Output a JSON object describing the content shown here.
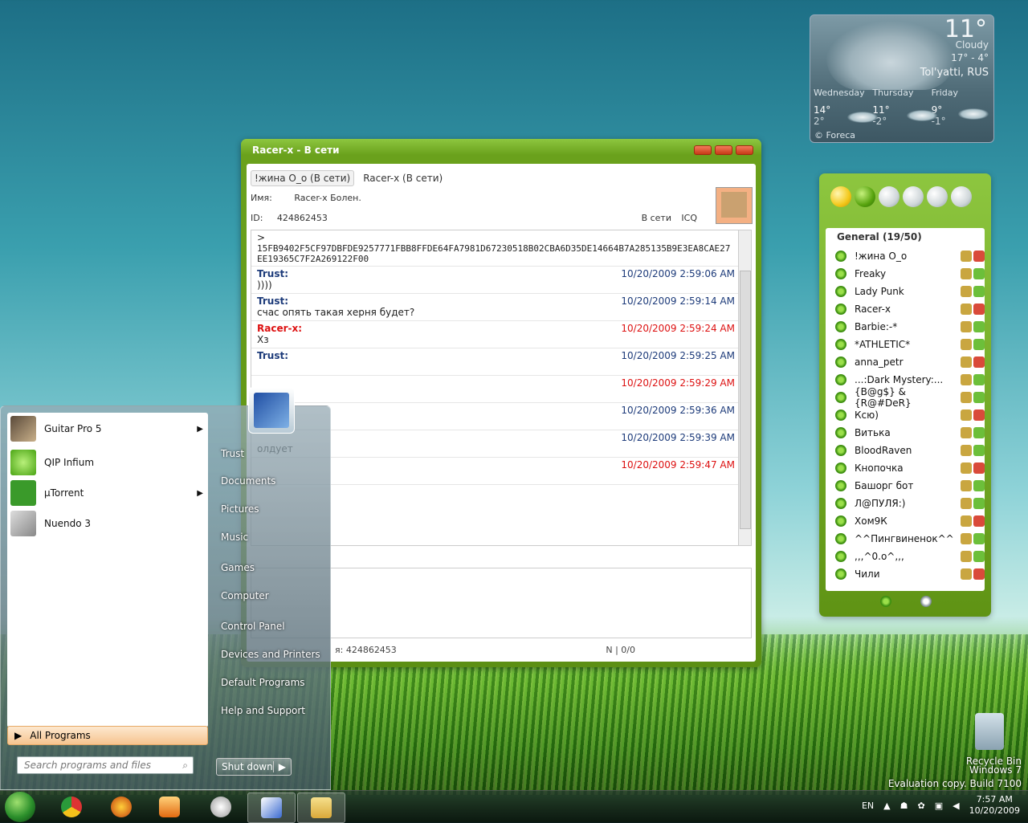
{
  "weather": {
    "temp": "11°",
    "condition": "Cloudy",
    "range": "17° - 4°",
    "city": "Tol'yatti, RUS",
    "days": [
      {
        "name": "Wednesday",
        "high": "14°",
        "low": "2°"
      },
      {
        "name": "Thursday",
        "high": "11°",
        "low": "-2°"
      },
      {
        "name": "Friday",
        "high": "9°",
        "low": "-1°"
      }
    ],
    "footer": "© Foreca"
  },
  "chat": {
    "title": "Racer-x - В сети",
    "tabs": [
      "!жина О_о (В сети)",
      "Racer-x (В сети)"
    ],
    "name_label": "Имя:",
    "name_value": "Racer-x  Болен.",
    "id_label": "ID:",
    "id_value": "424862453",
    "status_online": "В сети",
    "protocol": "ICQ",
    "first_line": ">",
    "hash": "15FB9402F5CF97DBFDE9257771FBB8FFDE64FA7981D67230518B02CBA6D35DE14664B7A285135B9E3EA8CAE27EE19365C7F2A269122F00",
    "messages": [
      {
        "author": "Trust:",
        "time": "10/20/2009 2:59:06 AM",
        "text": "))))",
        "red": false
      },
      {
        "author": "Trust:",
        "time": "10/20/2009 2:59:14 AM",
        "text": "счас опять такая херня будет?",
        "red": false
      },
      {
        "author": "Racer-x:",
        "time": "10/20/2009 2:59:24 AM",
        "text": "Хз",
        "red": true
      },
      {
        "author": "Trust:",
        "time": "10/20/2009 2:59:25 AM",
        "text": "",
        "red": false
      },
      {
        "author": "",
        "time": "10/20/2009 2:59:29 AM",
        "text": "",
        "red": true
      },
      {
        "author": "",
        "time": "10/20/2009 2:59:36 AM",
        "text": "",
        "red": false
      },
      {
        "author": "",
        "time": "10/20/2009 2:59:39 AM",
        "text": "олдует",
        "red": false
      },
      {
        "author": "",
        "time": "10/20/2009 2:59:47 AM",
        "text": "",
        "red": true
      }
    ],
    "status_id": "я: 424862453",
    "counter": "N | 0/0"
  },
  "qip": {
    "group": "General (19/50)",
    "contacts": [
      "!жина О_о",
      "Freaky",
      "Lady Punk",
      "Racer-x",
      "Barbie:-*",
      "*ATHLETIC*",
      "anna_petr",
      "...:Dark Mystery:...",
      "{B@g$} & {R@#DeR}",
      "Ксю)",
      "Витька",
      "BloodRaven",
      "Кнопочка",
      "Башорг бот",
      "Л@ПУЛЯ:)",
      "Хом9К",
      "^^Пингвиненок^^",
      ",,,^0.o^,,,",
      "Чили"
    ]
  },
  "start_menu": {
    "pinned": [
      "Guitar Pro 5",
      "QIP Infium",
      "µTorrent",
      "Nuendo 3"
    ],
    "all_programs": "All Programs",
    "search_placeholder": "Search programs and files",
    "right_items": [
      "Trust",
      "Documents",
      "Pictures",
      "Music",
      "Games",
      "Computer",
      "Control Panel",
      "Devices and Printers",
      "Default Programs",
      "Help and Support"
    ],
    "shutdown": "Shut down"
  },
  "desktop": {
    "recycle_bin": "Recycle Bin",
    "watermark_line1": "Windows 7",
    "watermark_line2": "Evaluation copy. Build 7100"
  },
  "taskbar": {
    "language": "EN",
    "time": "7:57 AM",
    "date": "10/20/2009"
  },
  "colors": {
    "qip_green": "#6aa11c",
    "message_blue": "#1d3b7a",
    "message_red": "#d11"
  }
}
